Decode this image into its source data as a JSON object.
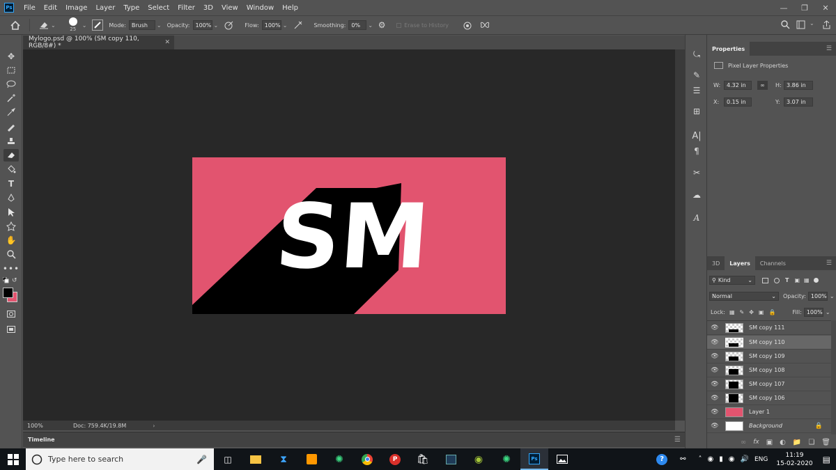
{
  "app": {
    "logo_text": "Ps"
  },
  "menu": [
    "File",
    "Edit",
    "Image",
    "Layer",
    "Type",
    "Select",
    "Filter",
    "3D",
    "View",
    "Window",
    "Help"
  ],
  "options": {
    "brush_size": "25",
    "mode_label": "Mode:",
    "mode_value": "Brush",
    "opacity_label": "Opacity:",
    "opacity_value": "100%",
    "flow_label": "Flow:",
    "flow_value": "100%",
    "smoothing_label": "Smoothing:",
    "smoothing_value": "0%",
    "erase_history_label": "Erase to History"
  },
  "document": {
    "tab_title": "Mylogo.psd @ 100% (SM copy 110, RGB/8#) *",
    "zoom": "100%",
    "doc_size": "Doc: 759.4K/19.8M",
    "artboard_color": "#e2546f",
    "logo_text": "SM"
  },
  "timeline": {
    "label": "Timeline"
  },
  "properties": {
    "tab": "Properties",
    "subtitle": "Pixel Layer Properties",
    "w_label": "W:",
    "w_value": "4.32 in",
    "h_label": "H:",
    "h_value": "3.86 in",
    "x_label": "X:",
    "x_value": "0.15 in",
    "y_label": "Y:",
    "y_value": "3.07 in"
  },
  "layers_panel": {
    "tabs": [
      "3D",
      "Layers",
      "Channels"
    ],
    "filter": "Kind",
    "blend_mode": "Normal",
    "opacity_label": "Opacity:",
    "opacity_value": "100%",
    "lock_label": "Lock:",
    "fill_label": "Fill:",
    "fill_value": "100%",
    "layers": [
      {
        "name": "SM copy 111"
      },
      {
        "name": "SM copy 110"
      },
      {
        "name": "SM copy 109"
      },
      {
        "name": "SM copy 108"
      },
      {
        "name": "SM copy 107"
      },
      {
        "name": "SM copy 106"
      },
      {
        "name": "Layer 1"
      },
      {
        "name": "Background"
      }
    ],
    "selected_layer": "SM copy 110",
    "layer1_color": "#e2546f"
  },
  "taskbar": {
    "search_placeholder": "Type here to search",
    "language": "ENG",
    "time": "11:19",
    "date": "15-02-2020"
  }
}
